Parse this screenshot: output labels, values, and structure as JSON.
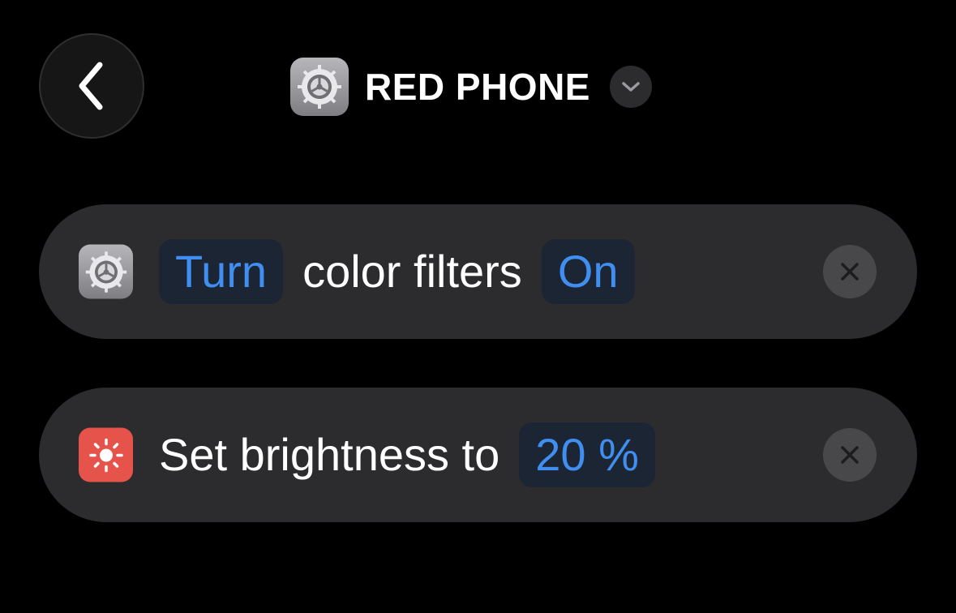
{
  "header": {
    "title": "RED PHONE",
    "app_icon": "settings-gear-icon",
    "back_icon": "chevron-left-icon",
    "menu_icon": "chevron-down-icon"
  },
  "actions": [
    {
      "icon": "settings-gear-icon",
      "icon_color": "#8e8e93",
      "verb": "Turn",
      "text": "color filters",
      "value": "On",
      "remove_icon": "close-icon"
    },
    {
      "icon": "sun-icon",
      "icon_color": "#e5534b",
      "text": "Set brightness to",
      "value": "20 %",
      "remove_icon": "close-icon"
    }
  ],
  "colors": {
    "background": "#000000",
    "card": "#2c2c2e",
    "token_text": "#3f8ef0",
    "token_bg": "#1c2534"
  }
}
